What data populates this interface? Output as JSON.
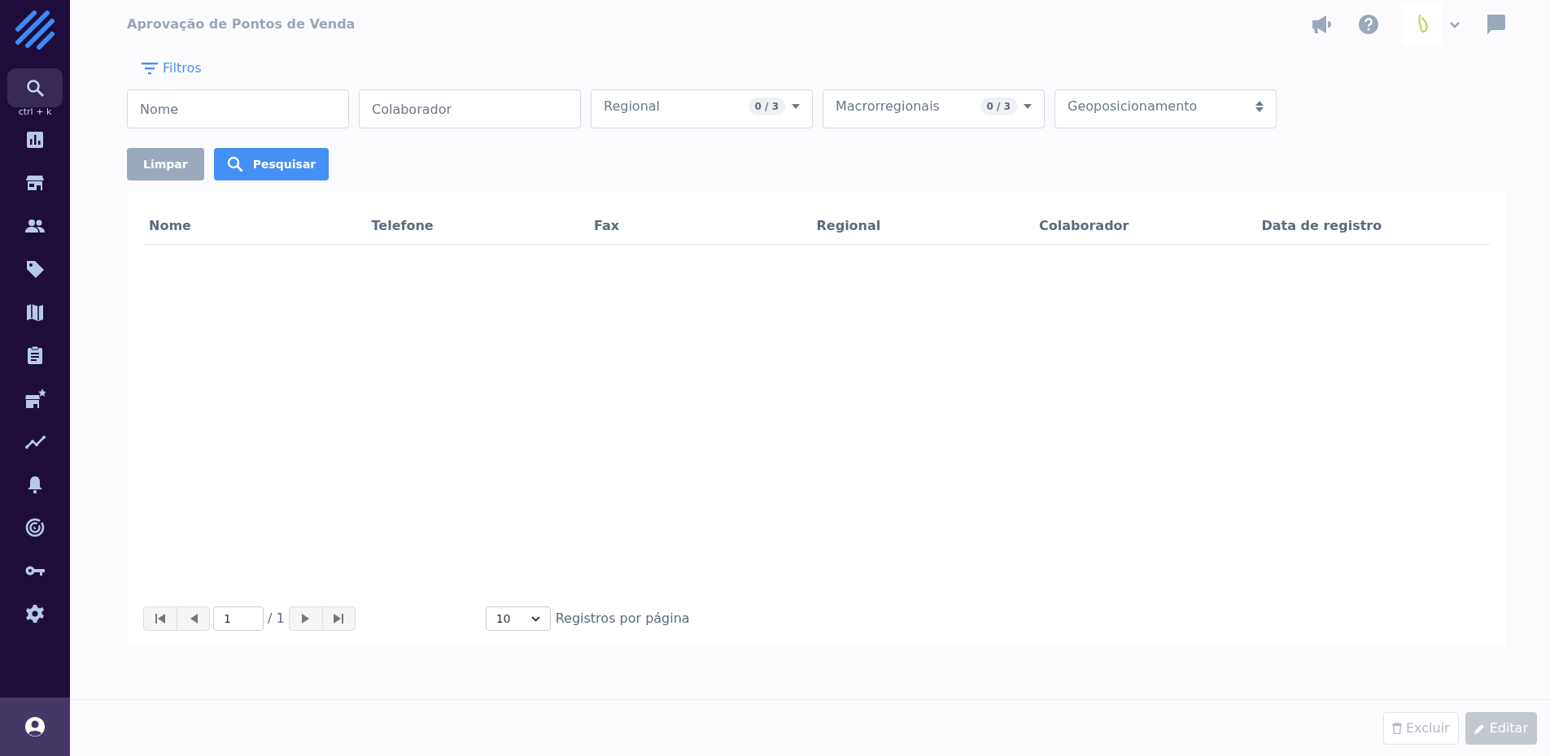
{
  "sidebar": {
    "items": [
      {
        "selected": true,
        "caption": "ctrl + k"
      },
      {
        "selected": false
      },
      {
        "selected": false
      },
      {
        "selected": false
      },
      {
        "selected": false
      },
      {
        "selected": false
      },
      {
        "selected": false
      },
      {
        "selected": false
      },
      {
        "selected": false
      },
      {
        "selected": false
      },
      {
        "selected": false
      },
      {
        "selected": false
      },
      {
        "selected": false
      }
    ]
  },
  "header": {
    "title": "Aprovação de Pontos de Venda"
  },
  "filters": {
    "label": "Filtros",
    "fields": [
      {
        "kind": "text",
        "placeholder": "Nome"
      },
      {
        "kind": "text",
        "placeholder": "Colaborador"
      },
      {
        "kind": "multiselect",
        "label": "Regional",
        "count": "0 / 3"
      },
      {
        "kind": "multiselect",
        "label": "Macrorregionais",
        "count": "0 / 3"
      },
      {
        "kind": "select",
        "label": "Geoposicionamento"
      }
    ],
    "buttons": [
      {
        "kind": "secondary",
        "label": "Limpar"
      },
      {
        "kind": "primary",
        "label": "Pesquisar"
      }
    ]
  },
  "table": {
    "columns": [
      "Nome",
      "Telefone",
      "Fax",
      "Regional",
      "Colaborador",
      "Data de registro"
    ]
  },
  "pagination": {
    "page": "1",
    "total": "/ 1",
    "page_size": "10",
    "page_size_label": "Registros por página"
  },
  "footer": {
    "buttons": [
      {
        "kind": "delete",
        "label": "Excluir",
        "disabled": true
      },
      {
        "kind": "edit",
        "label": "Editar",
        "disabled": true
      }
    ]
  }
}
